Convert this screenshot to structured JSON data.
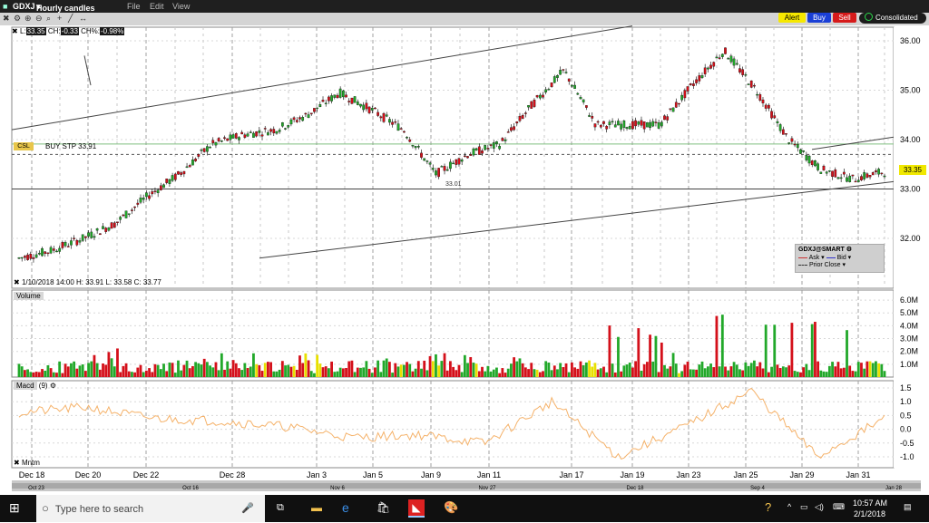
{
  "title_bar": {
    "symbol": "GDXJ",
    "chart_type": "Hourly candles",
    "menu": [
      "File",
      "Edit",
      "View"
    ]
  },
  "toolbar": {
    "alert_label": "Alert",
    "buy_label": "Buy",
    "sell_label": "Sell",
    "consolidated_label": "Consolidated"
  },
  "info_bar": {
    "last_label": "L:",
    "last": "33.35",
    "ch_label": "CH:",
    "ch": "-0.33",
    "chpct_label": "CH%:",
    "chpct": "-0.98%"
  },
  "order_line": {
    "tag": "CSL",
    "text": "BUY STP 33.91"
  },
  "bar_readout": "1/10/2018 14:00     H: 33.91   L: 33.58   C: 33.77",
  "low_marker": "33.01",
  "price_badge": "33.35",
  "legend": {
    "title": "GDXJ@SMART",
    "ask": "Ask",
    "bid": "Bid",
    "prior_close": "Prior Close"
  },
  "volume_panel_label": "Volume",
  "macd_panel": {
    "label": "Macd",
    "param": "(9)"
  },
  "mntm_label": "Mntm",
  "price_axis": [
    "36.00",
    "35.00",
    "34.00",
    "33.00",
    "32.00"
  ],
  "volume_axis": [
    "6.0M",
    "5.0M",
    "4.0M",
    "3.0M",
    "2.0M",
    "1.0M"
  ],
  "macd_axis": [
    "1.5",
    "1.0",
    "0.5",
    "0.0",
    "-0.5",
    "-1.0"
  ],
  "date_labels": [
    "Dec 18",
    "Dec 20",
    "Dec 22",
    "Dec 28",
    "Jan 3",
    "Jan 5",
    "Jan 9",
    "Jan 11",
    "Jan 17",
    "Jan 19",
    "Jan 23",
    "Jan 25",
    "Jan 29",
    "Jan 31"
  ],
  "scroll_labels": [
    "Oct 23",
    "Oct 16",
    "Nov 6",
    "Nov 27",
    "Dec 18",
    "Sep 4",
    "Jan 28"
  ],
  "taskbar": {
    "search_placeholder": "Type here to search",
    "time": "10:57 AM",
    "date": "2/1/2018"
  },
  "colors": {
    "up": "#22a82a",
    "down": "#d4101a",
    "neutral": "#e8e000",
    "macd_line": "#f5b26a",
    "grid": "#a0a0a0"
  },
  "chart_data": {
    "type": "candlestick",
    "title": "GDXJ Hourly candles",
    "ylim": [
      31.7,
      36.2
    ],
    "x": [
      "Dec 18",
      "Dec 20",
      "Dec 22",
      "Dec 28",
      "Jan 3",
      "Jan 5",
      "Jan 9",
      "Jan 11",
      "Jan 17",
      "Jan 19",
      "Jan 23",
      "Jan 25",
      "Jan 29",
      "Jan 31"
    ],
    "close_path": [
      [
        0,
        31.6
      ],
      [
        0.5,
        31.75
      ],
      [
        1,
        32.0
      ],
      [
        1.5,
        32.3
      ],
      [
        2,
        32.85
      ],
      [
        2.5,
        33.3
      ],
      [
        3,
        33.9
      ],
      [
        3.5,
        34.1
      ],
      [
        4,
        34.2
      ],
      [
        4.5,
        34.5
      ],
      [
        5,
        34.95
      ],
      [
        5.5,
        34.6
      ],
      [
        6,
        34.2
      ],
      [
        6.5,
        33.3
      ],
      [
        7,
        33.7
      ],
      [
        7.5,
        33.9
      ],
      [
        8,
        34.7
      ],
      [
        8.5,
        35.4
      ],
      [
        9,
        34.3
      ],
      [
        9.5,
        34.3
      ],
      [
        10,
        34.3
      ],
      [
        10.5,
        35.1
      ],
      [
        11,
        35.8
      ],
      [
        11.5,
        35.0
      ],
      [
        12,
        34.0
      ],
      [
        12.5,
        33.4
      ],
      [
        13,
        33.2
      ],
      [
        13.5,
        33.35
      ]
    ],
    "volume_M": [
      0.6,
      0.5,
      2.2,
      1.0,
      1.7,
      1.6,
      1.7,
      1.2,
      1.3,
      1.6,
      1.2,
      2.1,
      5.2,
      3.0,
      2.0,
      6.3,
      3.8,
      4.5,
      1.0
    ],
    "macd": [
      0.6,
      0.8,
      0.4,
      0.3,
      0.1,
      -0.3,
      -0.2,
      -0.5,
      1.0,
      -1.0,
      0.1,
      1.4,
      -1.0,
      0.4
    ]
  }
}
